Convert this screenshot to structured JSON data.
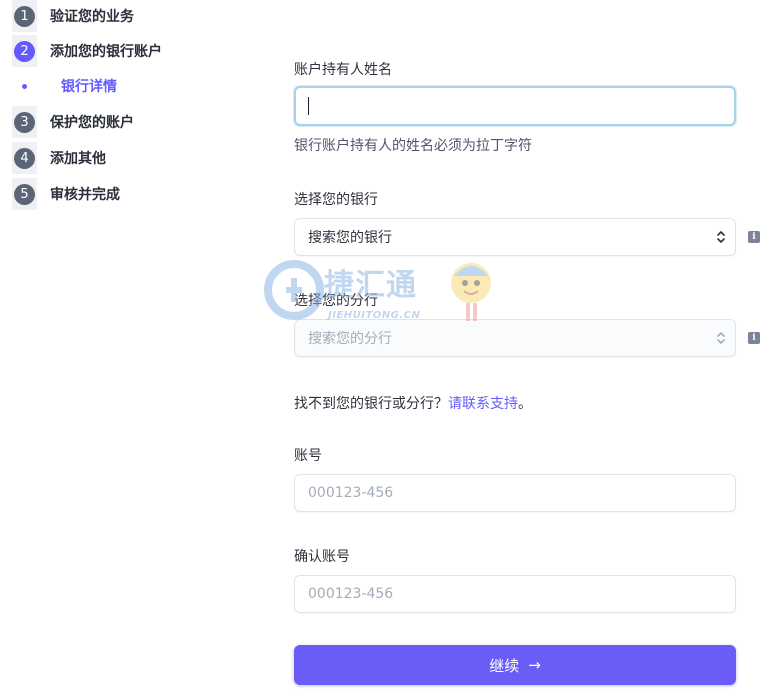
{
  "steps": [
    {
      "number": "1",
      "label": "验证您的业务",
      "active": false
    },
    {
      "number": "2",
      "label": "添加您的银行账户",
      "active": true
    },
    {
      "number": "3",
      "label": "保护您的账户",
      "active": false
    },
    {
      "number": "4",
      "label": "添加其他",
      "active": false
    },
    {
      "number": "5",
      "label": "审核并完成",
      "active": false
    }
  ],
  "substep": {
    "label": "银行详情"
  },
  "form": {
    "holder_label": "账户持有人姓名",
    "holder_value": "",
    "holder_help": "银行账户持有人的姓名必须为拉丁字符",
    "bank_label": "选择您的银行",
    "bank_placeholder": "搜索您的银行",
    "branch_label": "选择您的分行",
    "branch_placeholder": "搜索您的分行",
    "cant_find_text": "找不到您的银行或分行？",
    "contact_link": "请联系支持",
    "contact_suffix": "。",
    "account_label": "账号",
    "account_placeholder": "000123-456",
    "confirm_label": "确认账号",
    "confirm_placeholder": "000123-456",
    "continue_label": "继续",
    "continue_arrow": "→",
    "info_icon_glyph": "i"
  },
  "watermark": {
    "brand": "捷汇通",
    "domain": "JIEHUITONG.CN"
  },
  "colors": {
    "accent": "#635bff",
    "button": "#6a5cf7",
    "step_inactive": "#5c6576",
    "focus_border": "#a7d2e8"
  }
}
